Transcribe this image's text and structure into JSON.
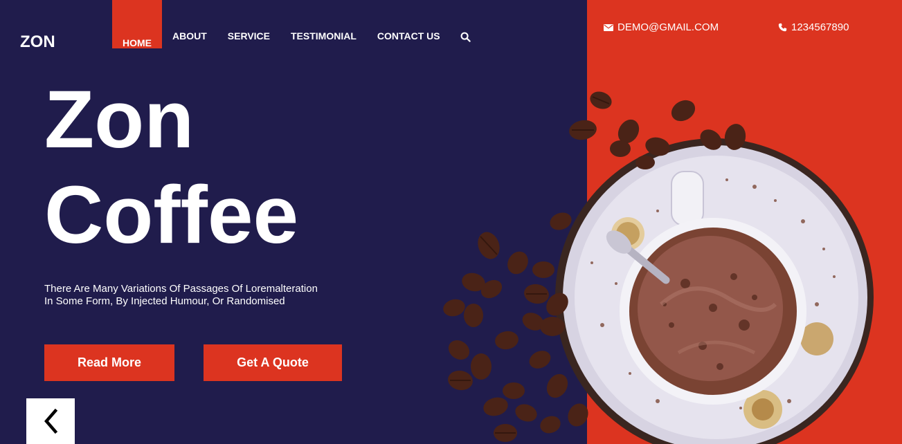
{
  "brand": {
    "name": "ZON"
  },
  "nav": {
    "items": [
      {
        "label": "HOME",
        "active": true
      },
      {
        "label": "ABOUT"
      },
      {
        "label": "SERVICE"
      },
      {
        "label": "TESTIMONIAL"
      },
      {
        "label": "CONTACT US"
      }
    ],
    "search_icon": "search-icon"
  },
  "contact": {
    "email": "DEMO@GMAIL.COM",
    "email_icon": "envelope-icon",
    "phone": "1234567890",
    "phone_icon": "phone-icon"
  },
  "hero": {
    "title_line1": "Zon",
    "title_line2": "Coffee",
    "description_line1": "There Are Many Variations Of Passages Of Loremalteration",
    "description_line2": "In Some Form, By Injected Humour, Or Randomised",
    "read_more_label": "Read More",
    "quote_label": "Get A Quote",
    "prev_arrow": "❮"
  },
  "colors": {
    "background": "#201c4c",
    "accent": "#dc3420",
    "text": "#ffffff"
  }
}
